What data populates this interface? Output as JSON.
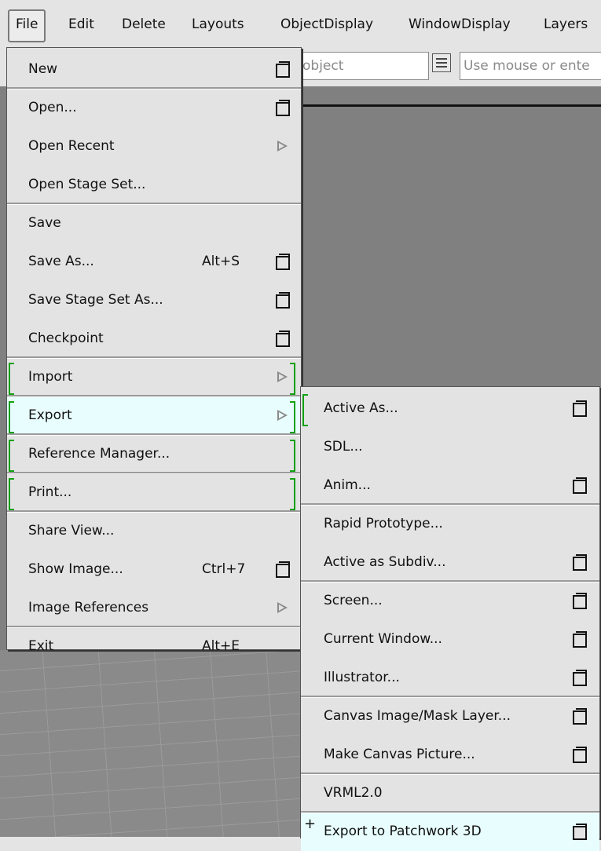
{
  "menubar": {
    "items": [
      {
        "label": "File",
        "active": true
      },
      {
        "label": "Edit"
      },
      {
        "label": "Delete"
      },
      {
        "label": "Layouts"
      },
      {
        "label": "ObjectDisplay"
      },
      {
        "label": "WindowDisplay"
      },
      {
        "label": "Layers"
      }
    ]
  },
  "toolbar": {
    "object_field": "object",
    "command_field": "Use mouse or ente"
  },
  "file_menu": {
    "items": [
      {
        "label": "New",
        "option_box": true
      },
      {
        "label": "Open...",
        "option_box": true
      },
      {
        "label": "Open Recent",
        "submenu": true
      },
      {
        "label": "Open Stage Set..."
      },
      {
        "label": "Save"
      },
      {
        "label": "Save As...",
        "shortcut": "Alt+S",
        "option_box": true
      },
      {
        "label": "Save Stage Set As...",
        "option_box": true
      },
      {
        "label": "Checkpoint",
        "option_box": true
      },
      {
        "label": "Import",
        "submenu": true,
        "bracket_left": true,
        "bracket_right": true
      },
      {
        "label": "Export",
        "submenu": true,
        "bracket_left": true,
        "bracket_right": true,
        "highlighted": true
      },
      {
        "label": "Reference Manager...",
        "bracket_left": true,
        "bracket_right": true
      },
      {
        "label": "Print...",
        "bracket_left": true,
        "bracket_right": true
      },
      {
        "label": "Share View..."
      },
      {
        "label": "Show Image...",
        "shortcut": "Ctrl+7",
        "option_box": true
      },
      {
        "label": "Image References",
        "submenu": true
      },
      {
        "label": "Exit",
        "shortcut": "Alt+E"
      }
    ]
  },
  "export_menu": {
    "items": [
      {
        "label": "Active As...",
        "option_box": true,
        "bracket_left": true
      },
      {
        "label": "SDL..."
      },
      {
        "label": "Anim...",
        "option_box": true
      },
      {
        "label": "Rapid Prototype..."
      },
      {
        "label": "Active as Subdiv...",
        "option_box": true
      },
      {
        "label": "Screen...",
        "option_box": true
      },
      {
        "label": "Current Window...",
        "option_box": true
      },
      {
        "label": "Illustrator...",
        "option_box": true
      },
      {
        "label": "Canvas Image/Mask Layer...",
        "option_box": true
      },
      {
        "label": "Make Canvas Picture...",
        "option_box": true
      },
      {
        "label": "VRML2.0"
      },
      {
        "label": "Export to Patchwork 3D",
        "option_box": true,
        "plus_mark": "+",
        "highlighted": true
      }
    ]
  }
}
